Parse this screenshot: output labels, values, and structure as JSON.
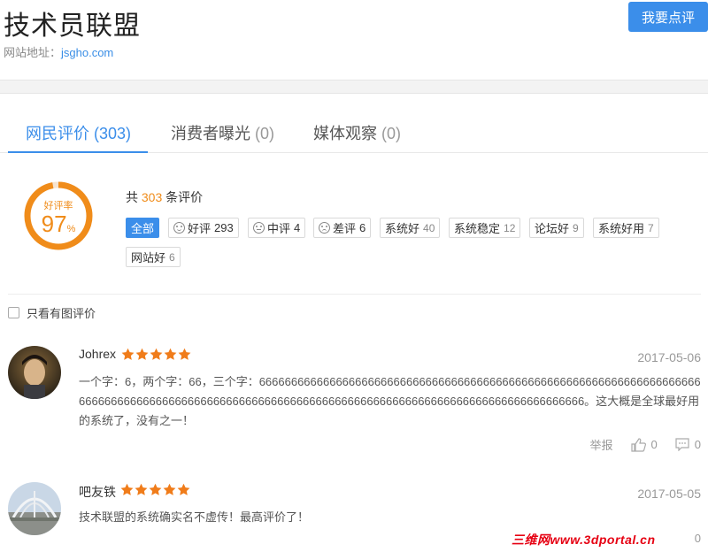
{
  "site": {
    "title": "技术员联盟",
    "url_label": "网站地址：",
    "url": "jsgho.com",
    "review_button": "我要点评"
  },
  "tabs": [
    {
      "label": "网民评价",
      "count": "(303)"
    },
    {
      "label": "消费者曝光",
      "count": "(0)"
    },
    {
      "label": "媒体观察",
      "count": "(0)"
    }
  ],
  "summary": {
    "rating_label": "好评率",
    "rating_value": "97",
    "rating_unit": "%",
    "rating_fraction": 0.97,
    "total_prefix": "共",
    "total_count": "303",
    "total_suffix": "条评价",
    "accent": "#f08c1a",
    "tags": [
      {
        "label": "全部",
        "count": ""
      },
      {
        "label": "好评",
        "count": "293",
        "icon": "smile-icon"
      },
      {
        "label": "中评",
        "count": "4",
        "icon": "neutral-face-icon"
      },
      {
        "label": "差评",
        "count": "6",
        "icon": "sad-face-icon"
      },
      {
        "label": "系统好",
        "count": "40"
      },
      {
        "label": "系统稳定",
        "count": "12"
      },
      {
        "label": "论坛好",
        "count": "9"
      },
      {
        "label": "系统好用",
        "count": "7"
      },
      {
        "label": "网站好",
        "count": "6"
      }
    ]
  },
  "filter": {
    "label": "只看有图评价",
    "checked": false
  },
  "reviews": [
    {
      "user": "Johrex",
      "stars": 5,
      "date": "2017-05-06",
      "content": "一个字：6，两个字：66，三个字：6666666666666666666666666666666666666666666666666666666666666666666666666666666666666666666666666666666666666666666666666666666666666666666666666666。这大概是全球最好用的系统了，没有之一！",
      "report": "举报",
      "likes": "0",
      "comments": "0"
    },
    {
      "user": "吧友铁",
      "stars": 5,
      "date": "2017-05-05",
      "content": "技术联盟的系统确实名不虚传！最高评价了！",
      "comments": "0"
    }
  ],
  "watermark": "三维网www.3dportal.cn",
  "colors": {
    "brand_blue": "#3b8eea",
    "star_orange": "#f07c1a"
  }
}
